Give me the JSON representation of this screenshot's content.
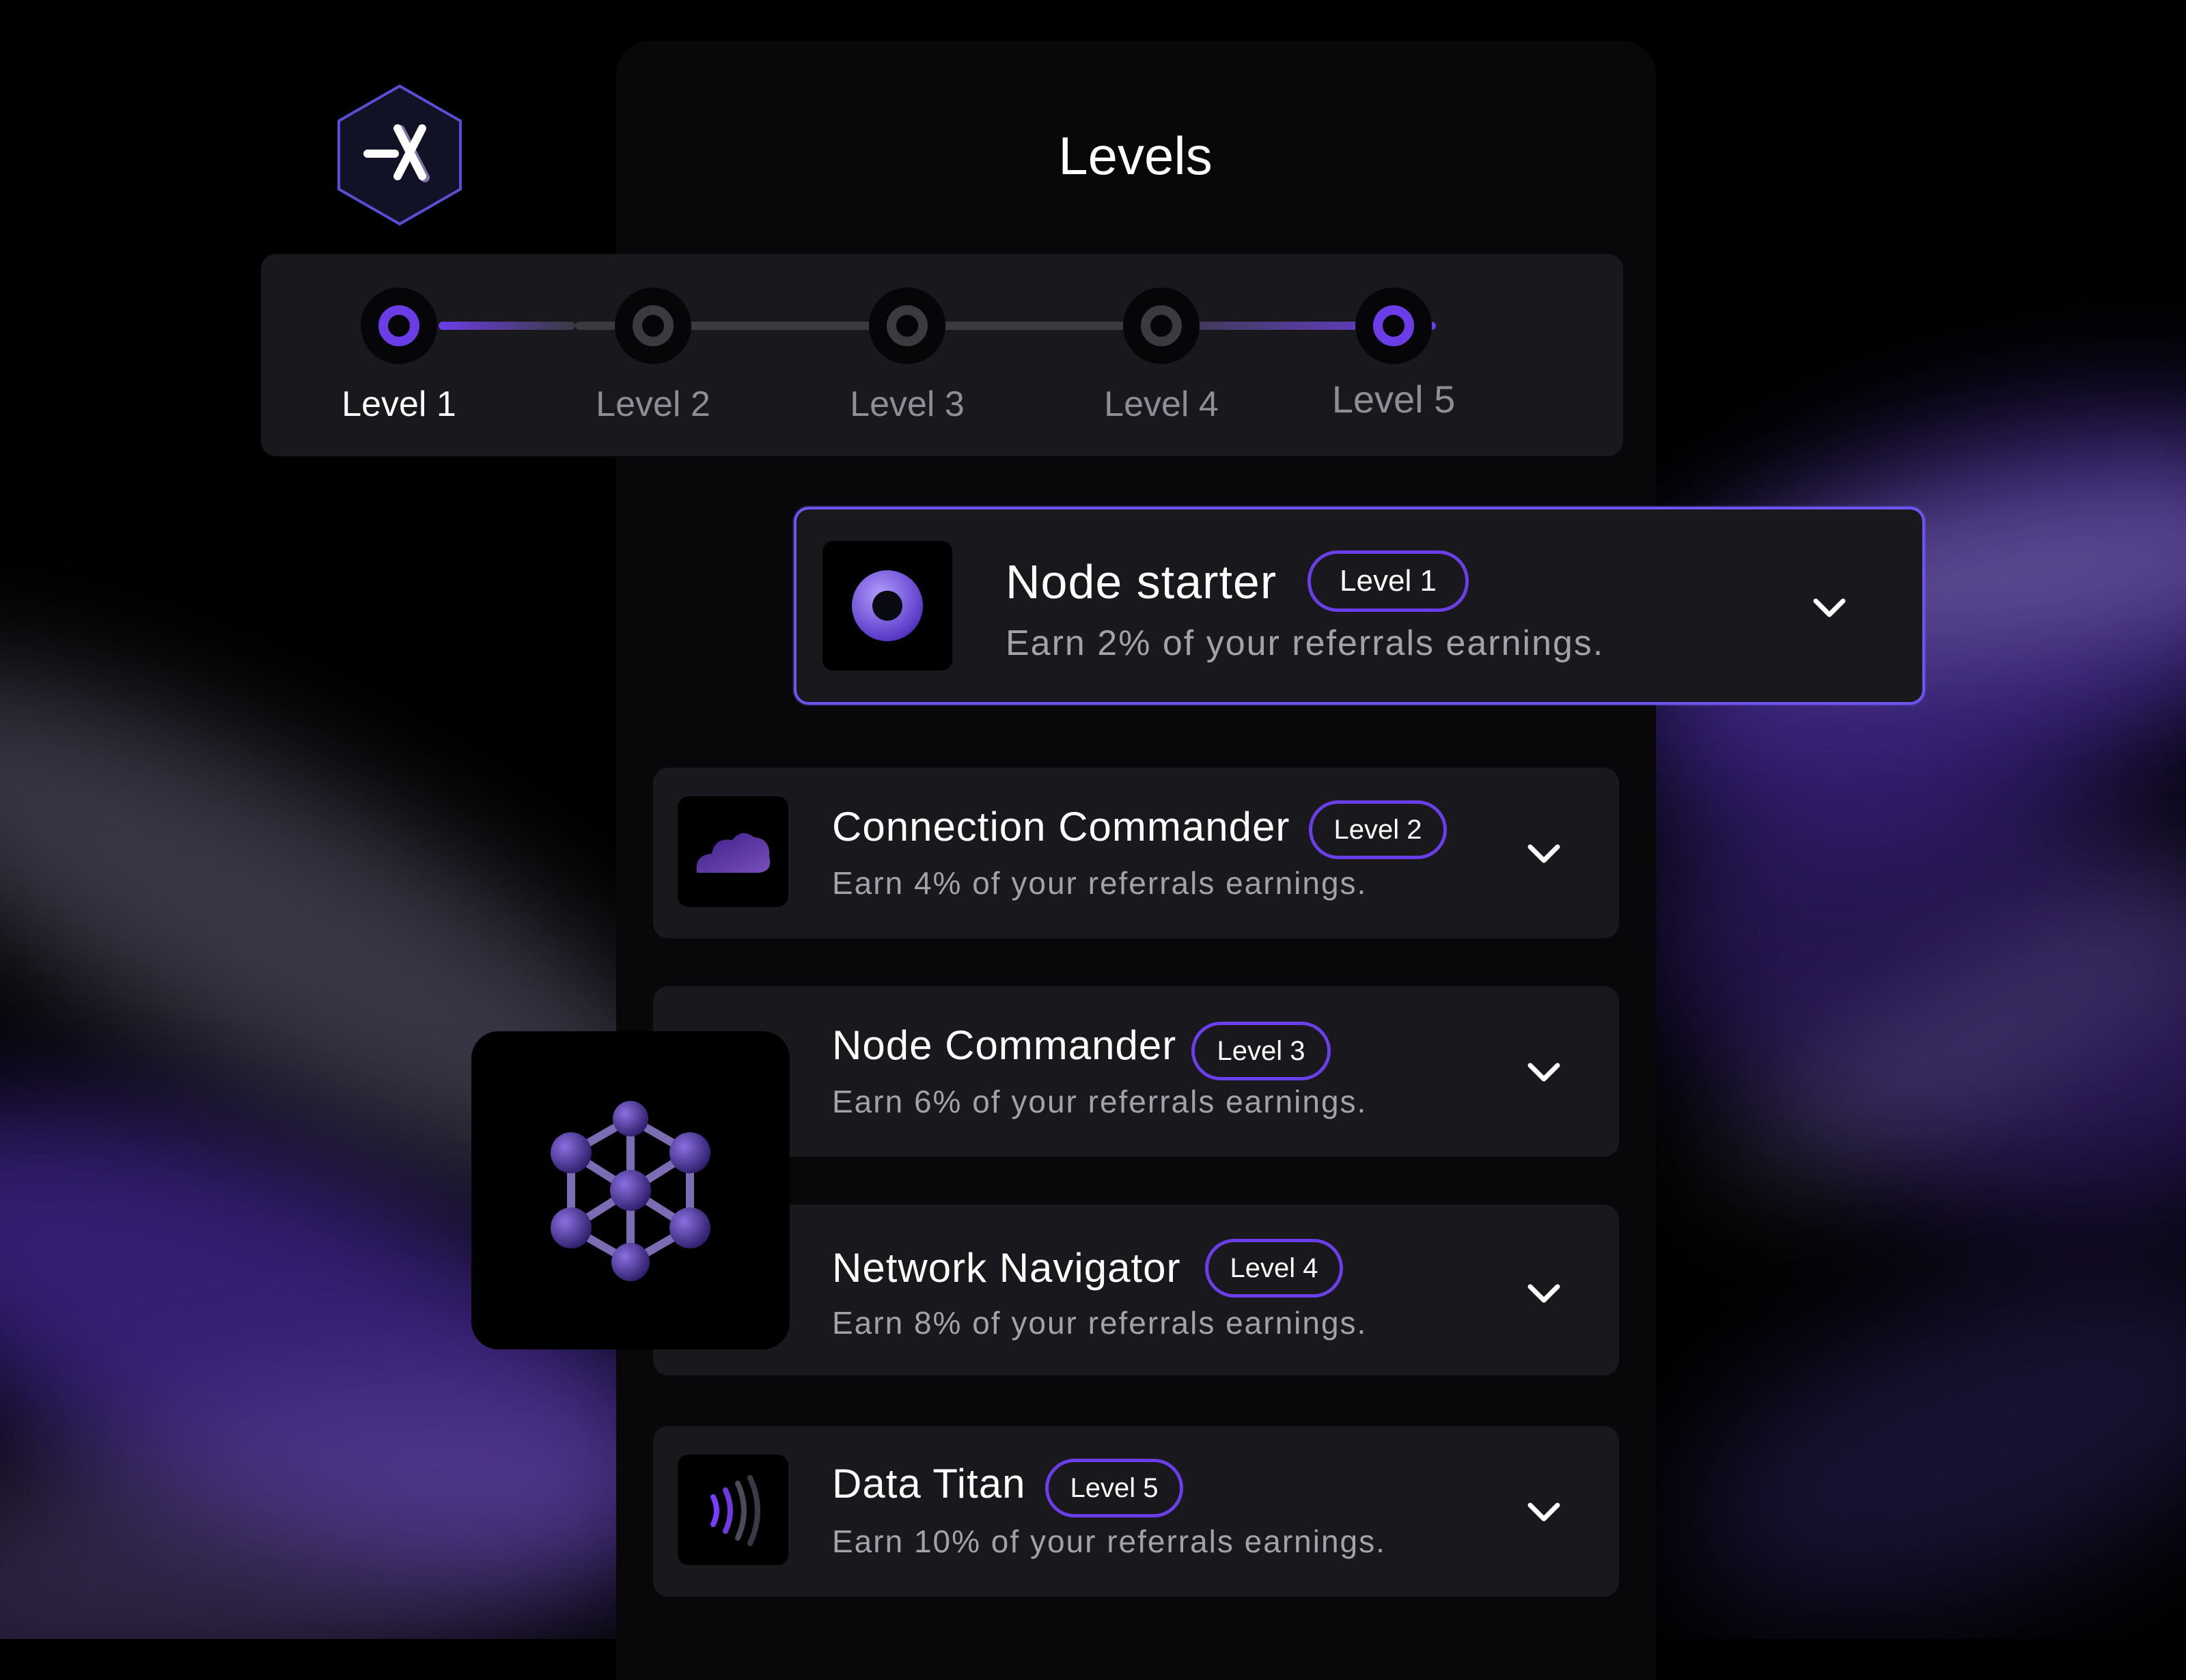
{
  "page": {
    "title": "Levels"
  },
  "stepper": {
    "steps": [
      {
        "label": "Level 1",
        "active": true
      },
      {
        "label": "Level 2",
        "active": false
      },
      {
        "label": "Level 3",
        "active": false
      },
      {
        "label": "Level 4",
        "active": false
      },
      {
        "label": "Level 5",
        "active": true
      }
    ]
  },
  "levels": [
    {
      "title": "Node starter",
      "badge": "Level 1",
      "description": "Earn 2% of your referrals earnings.",
      "icon": "ring-icon"
    },
    {
      "title": "Connection Commander",
      "badge": "Level 2",
      "description": "Earn 4% of your referrals earnings.",
      "icon": "cloud-icon"
    },
    {
      "title": "Node Commander",
      "badge": "Level 3",
      "description": "Earn 6% of your referrals earnings.",
      "icon": "node-network-icon"
    },
    {
      "title": "Network Navigator",
      "badge": "Level 4",
      "description": "Earn 8% of your referrals earnings.",
      "icon": ""
    },
    {
      "title": "Data Titan",
      "badge": "Level 5",
      "description": "Earn 10% of your referrals earnings.",
      "icon": "signal-waves-icon"
    }
  ],
  "colors": {
    "accent": "#6b3de6",
    "card_bg": "#18181d",
    "badge_border": "#6a3ee8",
    "featured_border": "#6d56f0"
  }
}
